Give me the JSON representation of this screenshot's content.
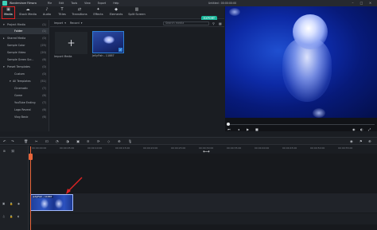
{
  "app": {
    "name": "Wondershare Filmora",
    "window_title": "Untitled : 00:00:00:00",
    "menu": [
      "File",
      "Edit",
      "Tools",
      "View",
      "Export",
      "Help"
    ]
  },
  "toolbar": {
    "tabs": [
      {
        "label": "Media",
        "icon": "media-icon",
        "active": true
      },
      {
        "label": "Stock Media",
        "icon": "stock-icon"
      },
      {
        "label": "Audio",
        "icon": "audio-icon"
      },
      {
        "label": "Titles",
        "icon": "titles-icon"
      },
      {
        "label": "Transitions",
        "icon": "transitions-icon"
      },
      {
        "label": "Effects",
        "icon": "effects-icon"
      },
      {
        "label": "Elements",
        "icon": "elements-icon"
      },
      {
        "label": "Split Screen",
        "icon": "split-screen-icon"
      }
    ],
    "export_label": "EXPORT",
    "accent_color": "#1bb69b",
    "highlight_color": "#e02424"
  },
  "sidebar": {
    "items": [
      {
        "label": "Project Media",
        "count": "(1)"
      },
      {
        "label": "Folder",
        "count": "(1)",
        "selected": true
      },
      {
        "label": "Shared Media",
        "count": "(0)"
      },
      {
        "label": "Sample Color",
        "count": "(25)"
      },
      {
        "label": "Sample Video",
        "count": "(20)"
      },
      {
        "label": "Sample Green Scr...",
        "count": "(6)"
      },
      {
        "label": "Preset Templates",
        "count": "(0)"
      },
      {
        "label": "Custom",
        "count": "(0)"
      },
      {
        "label": "All Templates",
        "count": "(51)"
      },
      {
        "label": "Cinematic",
        "count": "(7)"
      },
      {
        "label": "Game",
        "count": "(6)"
      },
      {
        "label": "YouTube Ending",
        "count": "(7)"
      },
      {
        "label": "Logo Reveal",
        "count": "(6)"
      },
      {
        "label": "Vlog Basic",
        "count": "(6)"
      }
    ]
  },
  "media": {
    "import_label": "Import",
    "record_label": "Record",
    "search_placeholder": "Search media",
    "import_tile_label": "Import Media",
    "clip_label": "JellyFish - 11887"
  },
  "timeline": {
    "clip_label": "JellyFish - 11887",
    "ruler_labels": [
      "00:00:00:00",
      "00:00:05:00",
      "00:00:10:00",
      "00:00:15:00",
      "00:00:20:00",
      "00:00:25:00",
      "00:00:30:00",
      "00:00:35:00",
      "00:00:40:00",
      "00:00:45:00",
      "00:00:50:00",
      "00:00:55:00"
    ],
    "playhead_color": "#e8653a"
  }
}
